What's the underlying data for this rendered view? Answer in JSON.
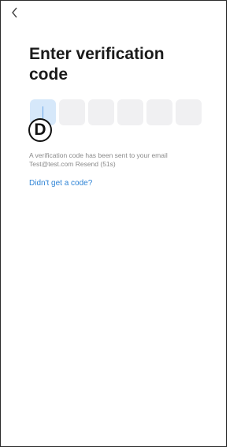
{
  "nav": {
    "back_glyph": "<"
  },
  "title": "Enter verification code",
  "code_input": {
    "length": 6,
    "entered": "",
    "active_index": 0,
    "colors": {
      "box": "#f0f0f2",
      "active_box": "#d6e8fa",
      "cursor": "#6aa7e8"
    }
  },
  "marker_label": "D",
  "hint": {
    "line1": "A verification code has been sent to your email",
    "email": "Test@test.com",
    "resend": "Resend (51s)"
  },
  "no_code_link": "Didn't get a code?",
  "colors": {
    "link": "#2f84d6",
    "hint_text": "#8a8a8a",
    "title_text": "#1b1b1b"
  }
}
